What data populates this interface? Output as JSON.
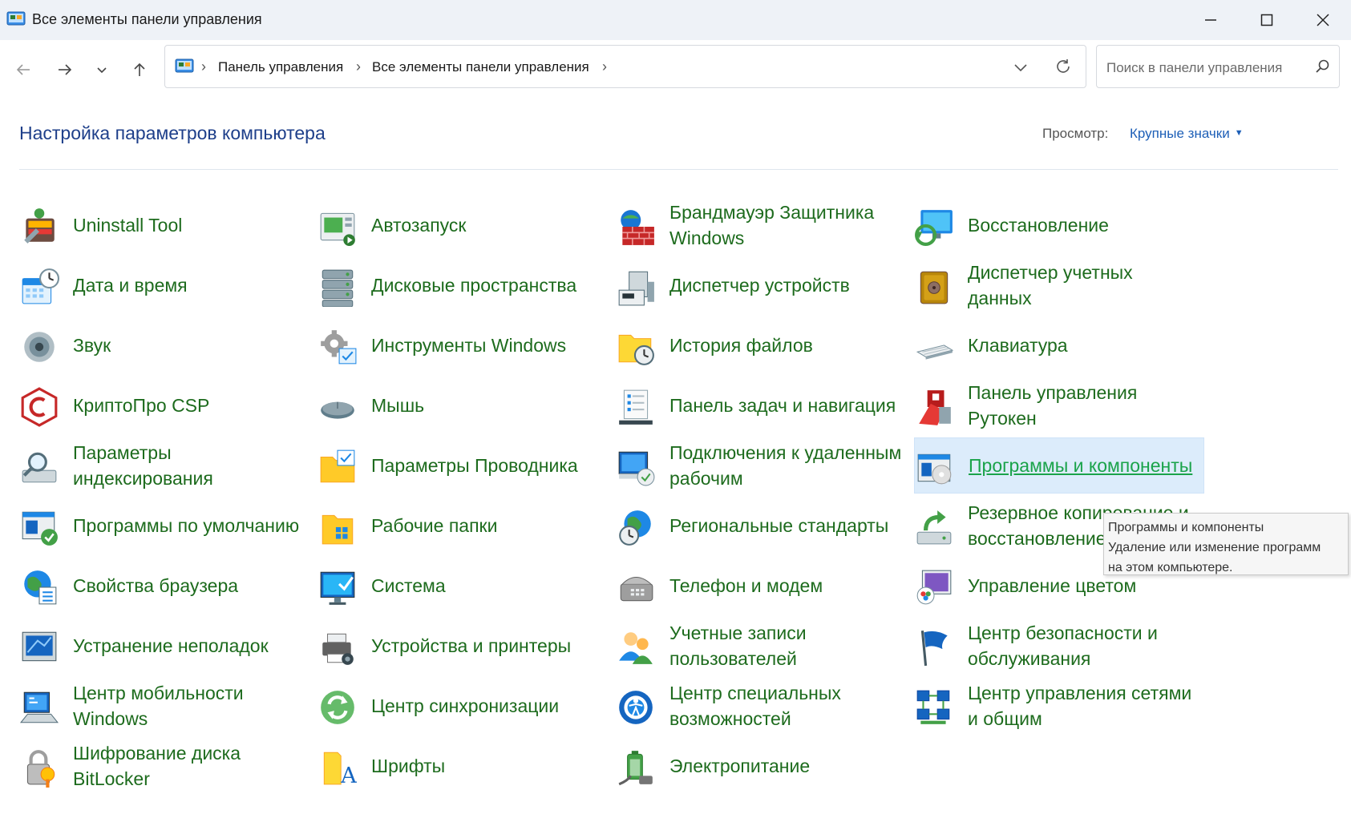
{
  "window": {
    "title": "Все элементы панели управления"
  },
  "address": {
    "crumbs": [
      "Панель управления",
      "Все элементы панели управления"
    ]
  },
  "search": {
    "placeholder": "Поиск в панели управления"
  },
  "header": {
    "title": "Настройка параметров компьютера",
    "view_label": "Просмотр:",
    "view_value": "Крупные значки"
  },
  "items": [
    {
      "label": "Uninstall Tool",
      "icon": "uninstall-tool-icon"
    },
    {
      "label": "Автозапуск",
      "icon": "autoplay-icon"
    },
    {
      "label": "Брандмауэр Защитника Windows",
      "icon": "firewall-icon"
    },
    {
      "label": "Восстановление",
      "icon": "recovery-icon"
    },
    {
      "label": "Дата и время",
      "icon": "date-time-icon"
    },
    {
      "label": "Дисковые пространства",
      "icon": "storage-spaces-icon"
    },
    {
      "label": "Диспетчер устройств",
      "icon": "device-manager-icon"
    },
    {
      "label": "Диспетчер учетных данных",
      "icon": "credential-manager-icon"
    },
    {
      "label": "Звук",
      "icon": "sound-icon"
    },
    {
      "label": "Инструменты Windows",
      "icon": "windows-tools-icon"
    },
    {
      "label": "История файлов",
      "icon": "file-history-icon"
    },
    {
      "label": "Клавиатура",
      "icon": "keyboard-icon"
    },
    {
      "label": "КриптоПро CSP",
      "icon": "cryptopro-icon"
    },
    {
      "label": "Мышь",
      "icon": "mouse-icon"
    },
    {
      "label": "Панель задач и навигация",
      "icon": "taskbar-icon"
    },
    {
      "label": "Панель управления Рутокен",
      "icon": "rutoken-icon"
    },
    {
      "label": "Параметры индексирования",
      "icon": "indexing-icon"
    },
    {
      "label": "Параметры Проводника",
      "icon": "explorer-options-icon"
    },
    {
      "label": "Подключения к удаленным рабочим",
      "icon": "remote-desktop-icon"
    },
    {
      "label": "Программы и компоненты",
      "icon": "programs-features-icon"
    },
    {
      "label": "Программы по умолчанию",
      "icon": "default-programs-icon"
    },
    {
      "label": "Рабочие папки",
      "icon": "work-folders-icon"
    },
    {
      "label": "Региональные стандарты",
      "icon": "region-icon"
    },
    {
      "label": "Резервное копирование и восстановление",
      "icon": "backup-icon"
    },
    {
      "label": "Свойства браузера",
      "icon": "internet-options-icon"
    },
    {
      "label": "Система",
      "icon": "system-icon"
    },
    {
      "label": "Телефон и модем",
      "icon": "phone-modem-icon"
    },
    {
      "label": "Управление цветом",
      "icon": "color-management-icon"
    },
    {
      "label": "Устранение неполадок",
      "icon": "troubleshooting-icon"
    },
    {
      "label": "Устройства и принтеры",
      "icon": "devices-printers-icon"
    },
    {
      "label": "Учетные записи пользователей",
      "icon": "user-accounts-icon"
    },
    {
      "label": "Центр безопасности и обслуживания",
      "icon": "security-maintenance-icon"
    },
    {
      "label": "Центр мобильности Windows",
      "icon": "mobility-center-icon"
    },
    {
      "label": "Центр синхронизации",
      "icon": "sync-center-icon"
    },
    {
      "label": "Центр специальных возможностей",
      "icon": "ease-of-access-icon"
    },
    {
      "label": "Центр управления сетями и общим",
      "icon": "network-center-icon"
    },
    {
      "label": "Шифрование диска BitLocker",
      "icon": "bitlocker-icon"
    },
    {
      "label": "Шрифты",
      "icon": "fonts-icon"
    },
    {
      "label": "Электропитание",
      "icon": "power-options-icon"
    }
  ],
  "tooltip": {
    "title": "Программы и компоненты",
    "line1": "Удаление или изменение программ",
    "line2": "на этом компьютере."
  },
  "colors": {
    "link_green": "#1d6b1d",
    "header_blue": "#1e3f8a",
    "hover_bg": "#dcecfb"
  }
}
